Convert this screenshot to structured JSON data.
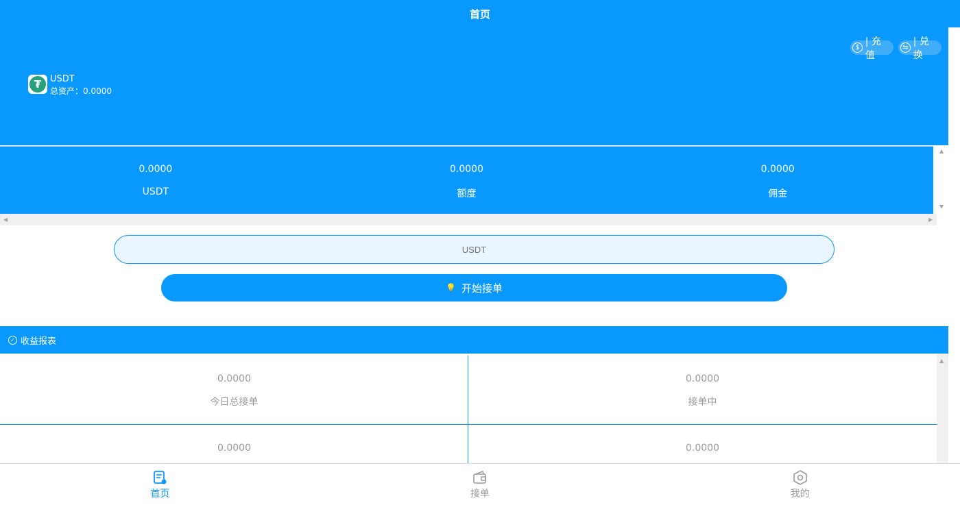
{
  "header": {
    "title": "首页"
  },
  "actions": {
    "recharge_label": "| 充值",
    "exchange_label": "| 兑换"
  },
  "asset": {
    "name": "USDT",
    "total_label": "总资产：",
    "total_value": "0.0000"
  },
  "stats": [
    {
      "value": "0.0000",
      "label": "USDT"
    },
    {
      "value": "0.0000",
      "label": "额度"
    },
    {
      "value": "0.0000",
      "label": "佣金"
    }
  ],
  "order_input": {
    "placeholder": "USDT"
  },
  "start_button": {
    "label": "开始接单"
  },
  "report": {
    "title": "收益报表",
    "cells": [
      {
        "value": "0.0000",
        "label": "今日总接单"
      },
      {
        "value": "0.0000",
        "label": "接单中"
      },
      {
        "value": "0.0000",
        "label": ""
      },
      {
        "value": "0.0000",
        "label": ""
      }
    ]
  },
  "tabbar": {
    "items": [
      {
        "label": "首页",
        "icon": "home-icon",
        "active": true
      },
      {
        "label": "接单",
        "icon": "wallet-icon",
        "active": false
      },
      {
        "label": "我的",
        "icon": "hexagon-icon",
        "active": false
      }
    ]
  },
  "colors": {
    "primary": "#0898fe",
    "muted_text": "#999999",
    "field_bg": "#e9f5ff"
  }
}
